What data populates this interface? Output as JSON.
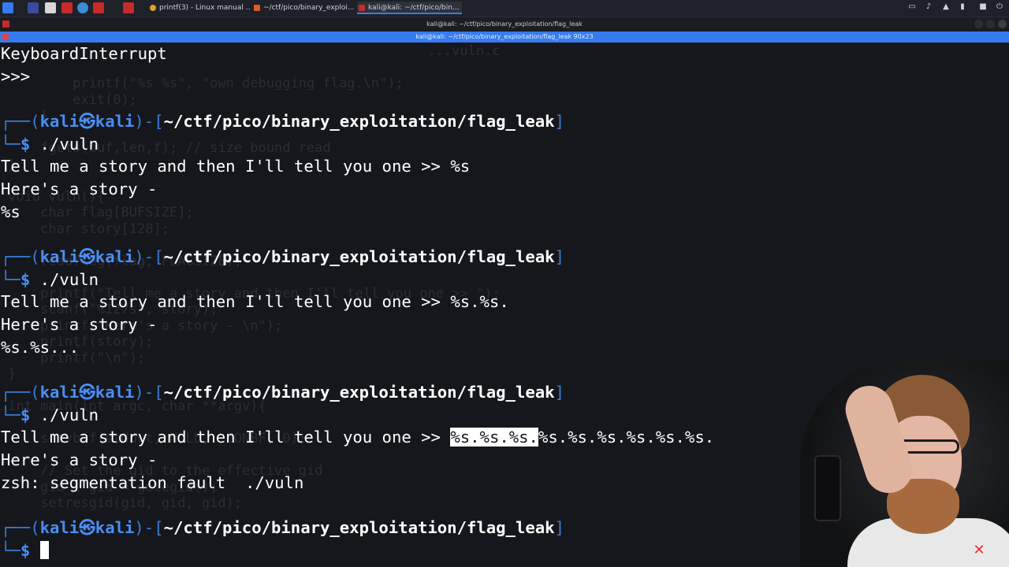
{
  "taskbar": {
    "tasks": [
      {
        "label": "printf(3) - Linux manual ...",
        "icon": "browser-icon",
        "color": "#e0a030"
      },
      {
        "label": "~/ctf/pico/binary_exploi...",
        "icon": "editor-icon",
        "color": "#e05a2a"
      },
      {
        "label": "kali@kali: ~/ctf/pico/bin...",
        "icon": "terminal-icon",
        "color": "#c62a2a"
      }
    ]
  },
  "window": {
    "title": "kali@kali: ~/ctf/pico/binary_exploitation/flag_leak",
    "tab_title": "kali@kali: ~/ctf/pico/binary_exploitation/flag_leak 90x23"
  },
  "terminal": {
    "lines": {
      "l0": "KeyboardInterrupt",
      "l1": ">>>",
      "p1_bar": "┌──(",
      "p1_user": "kali㉿kali",
      "p1_mid": ")-[",
      "p1_path": "~/ctf/pico/binary_exploitation/flag_leak",
      "p1_end": "]",
      "c1_prefix": "└─",
      "c1_dollar": "$",
      "c1_cmd": " ./vuln",
      "o1a": "Tell me a story and then I'll tell you one >> %s",
      "o1b": "Here's a story -",
      "o1c": "%s",
      "p2_bar": "┌──(",
      "p2_user": "kali㉿kali",
      "p2_mid": ")-[",
      "p2_path": "~/ctf/pico/binary_exploitation/flag_leak",
      "p2_end": "]",
      "c2_prefix": "└─",
      "c2_dollar": "$",
      "c2_cmd": " ./vuln",
      "o2a": "Tell me a story and then I'll tell you one >> %s.%s.",
      "o2b": "Here's a story -",
      "o2c": "%s.%s...",
      "p3_bar": "┌──(",
      "p3_user": "kali㉿kali",
      "p3_mid": ")-[",
      "p3_path": "~/ctf/pico/binary_exploitation/flag_leak",
      "p3_end": "]",
      "c3_prefix": "└─",
      "c3_dollar": "$",
      "c3_cmd": " ./vuln",
      "o3a_pre": "Tell me a story and then I'll tell you one >> ",
      "o3a_sel": "%s.%s.%s.",
      "o3a_post": "%s.%s.%s.%s.%s.%s.",
      "o3b": "Here's a story -",
      "o3c": "zsh: segmentation fault  ./vuln",
      "p4_bar": "┌──(",
      "p4_user": "kali㉿kali",
      "p4_mid": ")-[",
      "p4_path": "~/ctf/pico/binary_exploitation/flag_leak",
      "p4_end": "]",
      "c4_prefix": "└─",
      "c4_dollar": "$"
    },
    "ghost_text": "                                                     ...vuln.c\n\n         printf(\"%s %s\", \"own debugging flag.\\n\");\n         exit(0);\n     }\n\n     fgets(buf,len,f); // size bound read\n }\n\n void vuln(){\n     char flag[BUFSIZE];\n     char story[128];\n\n     readflag(flag, FLAGSIZE);\n\n     printf(\"Tell me a story and then I'll tell you one >> \");\n     scanf(\"%127s\", story);\n     printf(\"Here's a story - \\n\");\n     printf(story);\n     printf(\"\\n\");\n }\n\n int main(int argc, char **argv){\n\n     setvbuf(stdout, NULL, _IONBF, 0);\n\n     // Set the gid to the effective gid\n     gid_t gid = getegid();\n     setresgid(gid, gid, gid);"
  },
  "colors": {
    "accent": "#367bf0",
    "prompt_blue": "#4a8ef5",
    "background": "#15171c",
    "text": "#ffffff"
  }
}
